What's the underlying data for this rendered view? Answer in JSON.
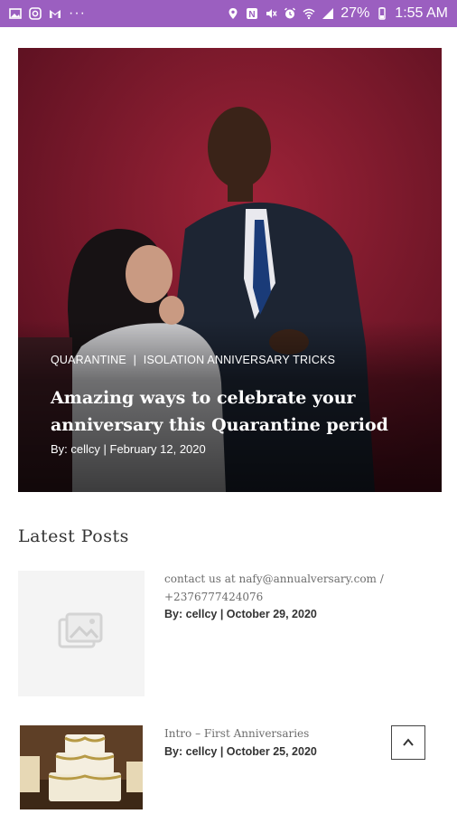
{
  "status_bar": {
    "battery": "27%",
    "time": "1:55 AM",
    "overflow": "···"
  },
  "hero": {
    "categories": [
      "QUARANTINE",
      "|",
      "ISOLATION ANNIVERSARY TRICKS"
    ],
    "title": "Amazing ways to celebrate your anniversary this Quarantine period",
    "meta": "By: cellcy | February 12, 2020"
  },
  "latest": {
    "heading": "Latest Posts",
    "posts": [
      {
        "title": "contact us at nafy@annualversary.com / +2376777424076",
        "meta": "By: cellcy | October 29, 2020"
      },
      {
        "title": "Intro – First Anniversaries",
        "meta": "By: cellcy | October 25, 2020"
      }
    ]
  },
  "colors": {
    "status_bar": "#9b5fc0",
    "hero_background": "#8a1d30"
  },
  "icons": {
    "status_left": [
      "gallery-icon",
      "instagram-icon",
      "gmail-icon"
    ],
    "status_right": [
      "location-icon",
      "nfc-icon",
      "mute-icon",
      "alarm-icon",
      "wifi-icon",
      "signal-icon",
      "battery-icon"
    ],
    "placeholder": "image-placeholder-icon",
    "scroll_top": "chevron-up-icon"
  }
}
